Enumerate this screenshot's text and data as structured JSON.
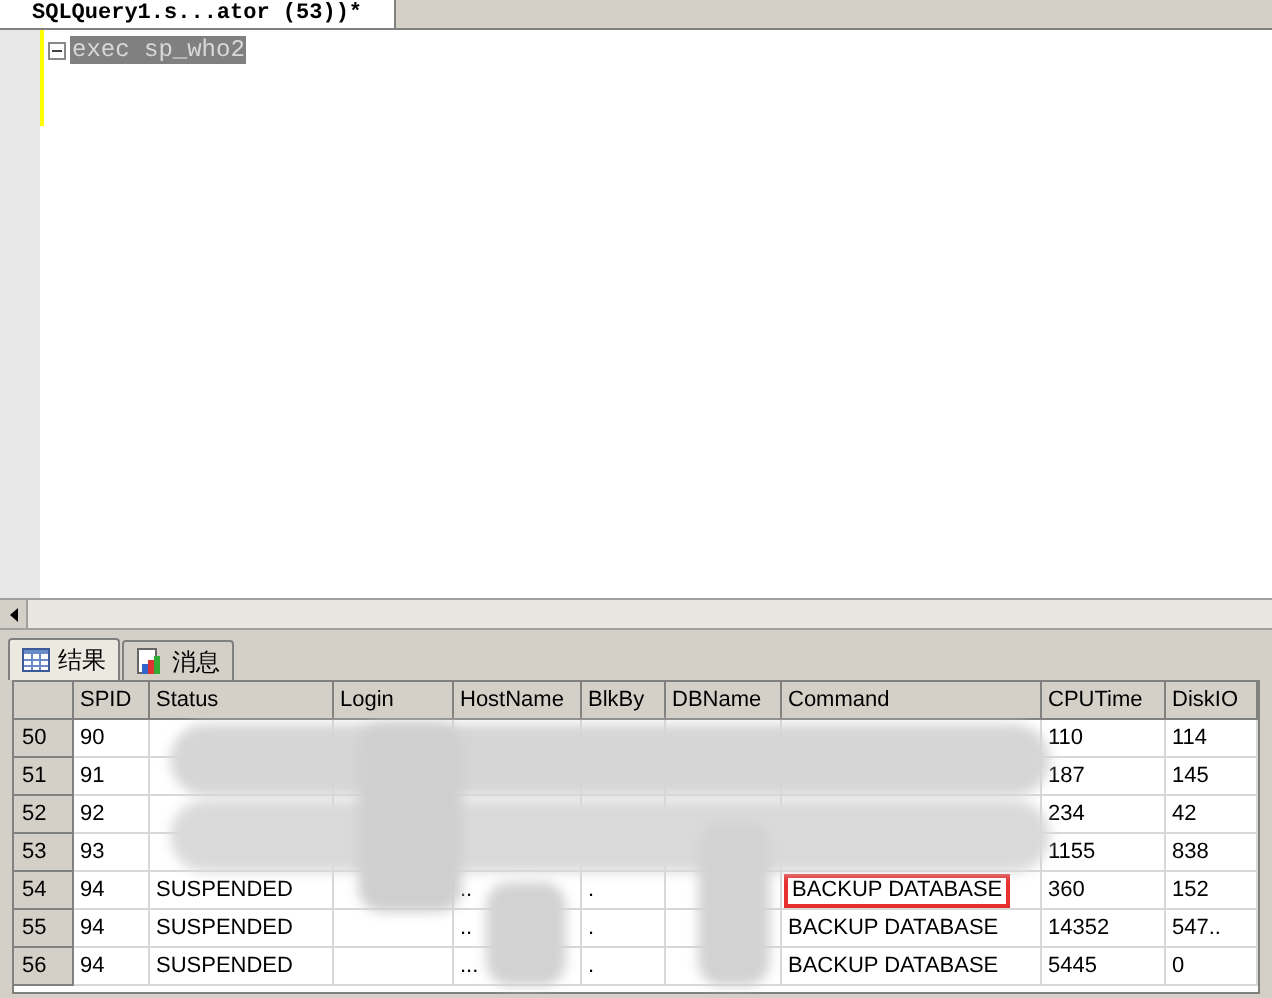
{
  "document_tab": {
    "title": "SQLQuery1.s...ator (53))*",
    "selected": true
  },
  "editor": {
    "lines": [
      "exec sp_who2"
    ]
  },
  "result_tabs": [
    {
      "label": "结果",
      "kind": "grid",
      "selected": true
    },
    {
      "label": "消息",
      "kind": "messages",
      "selected": false
    }
  ],
  "table": {
    "columns": [
      "SPID",
      "Status",
      "Login",
      "HostName",
      "BlkBy",
      "DBName",
      "Command",
      "CPUTime",
      "DiskIO"
    ],
    "rows": [
      {
        "row_number": "50",
        "cells": [
          "90",
          "",
          "",
          "",
          "",
          "",
          "",
          "110",
          "114"
        ],
        "highlighted": false
      },
      {
        "row_number": "51",
        "cells": [
          "91",
          "",
          "",
          "",
          "",
          "",
          "",
          "187",
          "145"
        ],
        "highlighted": false
      },
      {
        "row_number": "52",
        "cells": [
          "92",
          "",
          "",
          "",
          "",
          "",
          "",
          "234",
          "42"
        ],
        "highlighted": false
      },
      {
        "row_number": "53",
        "cells": [
          "93",
          "",
          "",
          "",
          "",
          "",
          "",
          "1155",
          "838"
        ],
        "highlighted": false
      },
      {
        "row_number": "54",
        "cells": [
          "94",
          "SUSPENDED",
          "",
          "..",
          ".",
          "",
          "BACKUP DATABASE",
          "360",
          "152"
        ],
        "highlighted": true
      },
      {
        "row_number": "55",
        "cells": [
          "94",
          "SUSPENDED",
          "",
          "..",
          ".",
          "",
          "BACKUP DATABASE",
          "14352",
          "547.."
        ],
        "highlighted": false
      },
      {
        "row_number": "56",
        "cells": [
          "94",
          "SUSPENDED",
          "",
          "...",
          ".",
          "",
          "BACKUP DATABASE",
          "5445",
          "0"
        ],
        "highlighted": false
      }
    ]
  }
}
